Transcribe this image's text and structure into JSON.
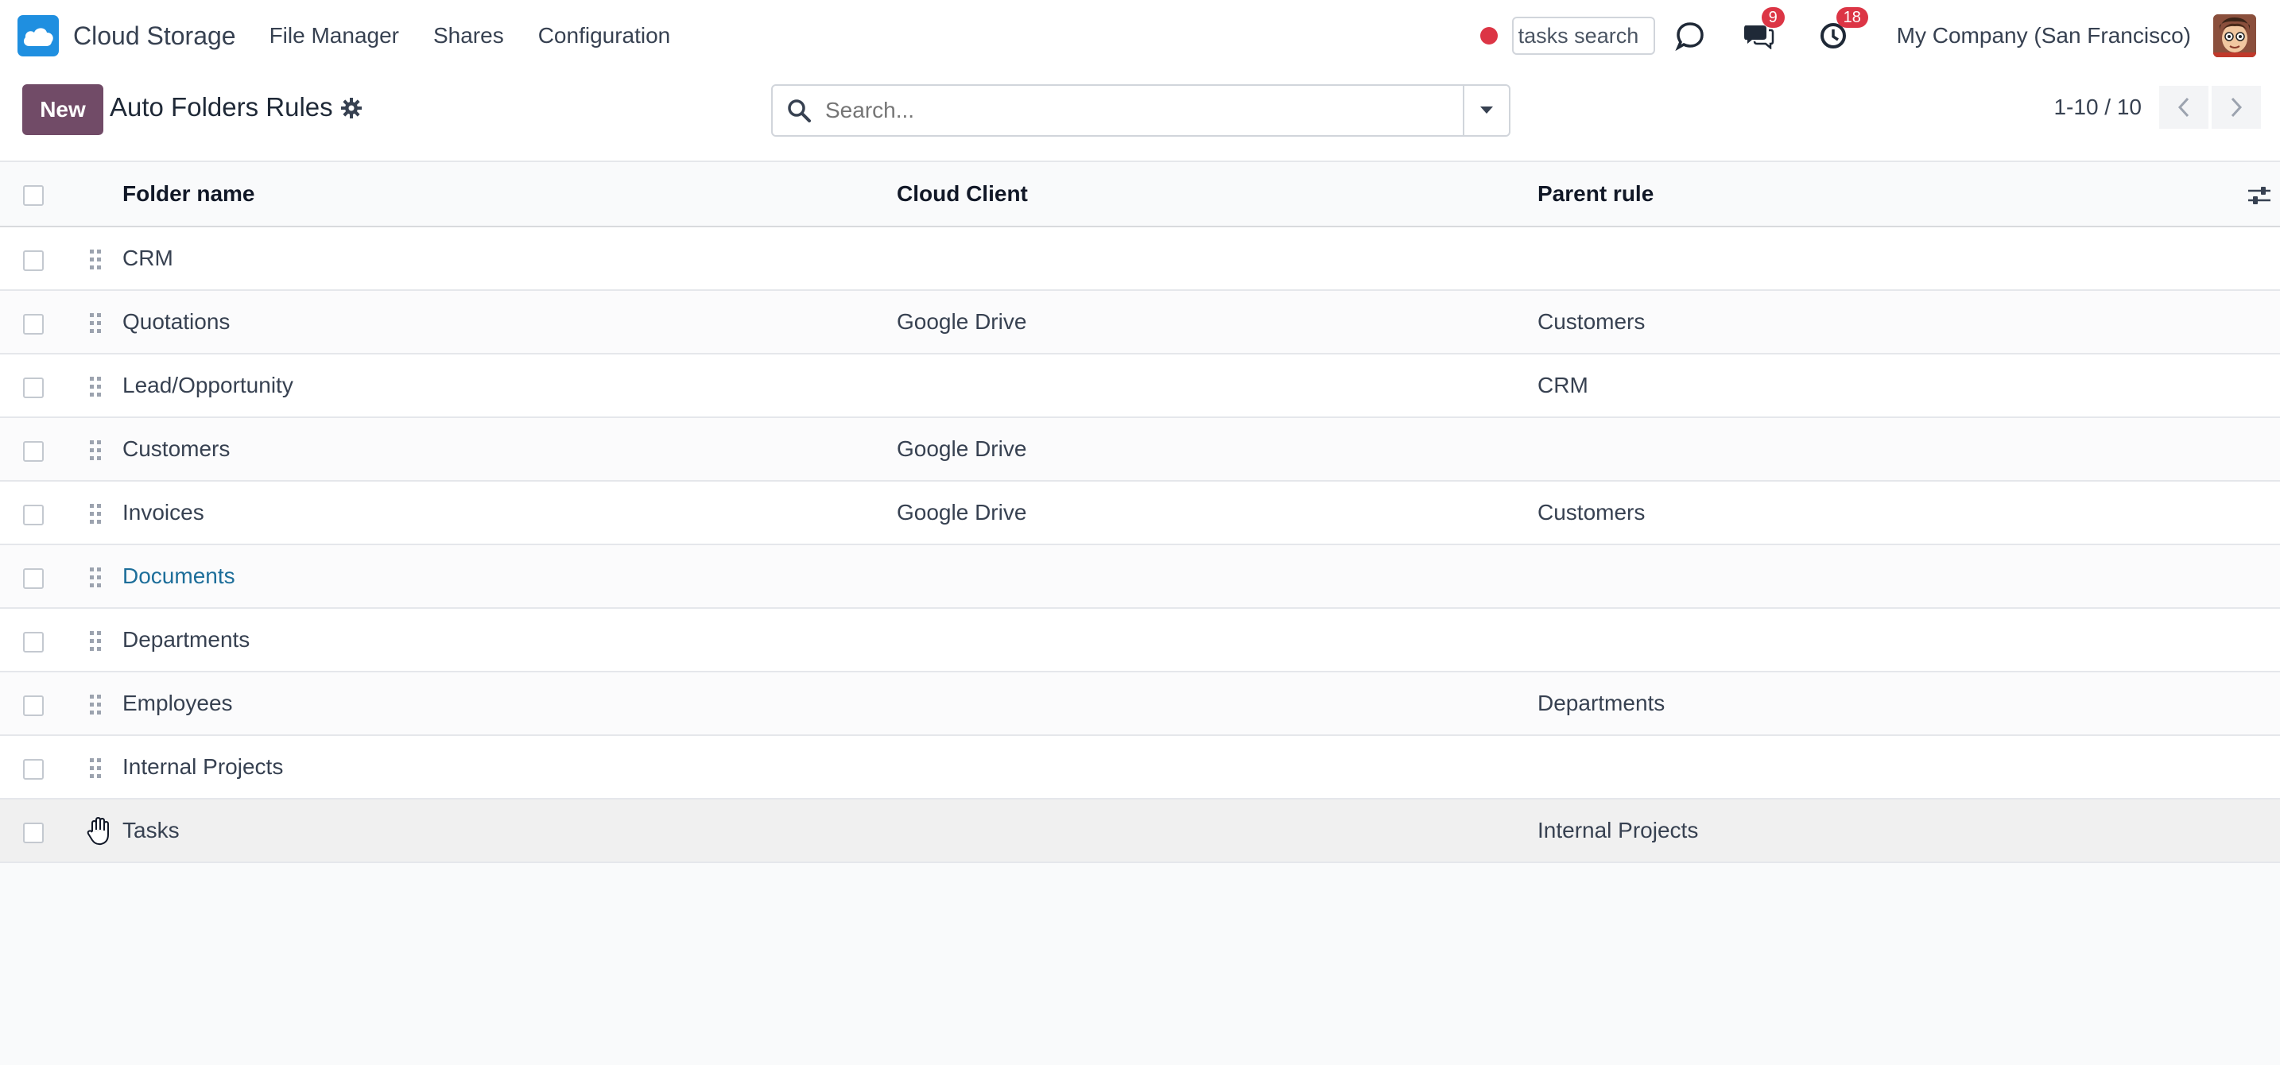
{
  "app": {
    "name": "Cloud Storage"
  },
  "menu": [
    "File Manager",
    "Shares",
    "Configuration"
  ],
  "systray": {
    "tasks_search_value": "tasks search",
    "messages_badge": "9",
    "activities_badge": "18",
    "company": "My Company (San Francisco)"
  },
  "control": {
    "new_label": "New",
    "title": "Auto Folders Rules",
    "search_placeholder": "Search...",
    "pager": "1-10 / 10"
  },
  "table": {
    "columns": [
      "Folder name",
      "Cloud Client",
      "Parent rule"
    ],
    "rows": [
      {
        "name": "CRM",
        "client": "",
        "parent": ""
      },
      {
        "name": "Quotations",
        "client": "Google Drive",
        "parent": "Customers"
      },
      {
        "name": "Lead/Opportunity",
        "client": "",
        "parent": "CRM"
      },
      {
        "name": "Customers",
        "client": "Google Drive",
        "parent": ""
      },
      {
        "name": "Invoices",
        "client": "Google Drive",
        "parent": "Customers"
      },
      {
        "name": "Documents",
        "client": "",
        "parent": ""
      },
      {
        "name": "Departments",
        "client": "",
        "parent": ""
      },
      {
        "name": "Employees",
        "client": "",
        "parent": "Departments"
      },
      {
        "name": "Internal Projects",
        "client": "",
        "parent": ""
      },
      {
        "name": "Tasks",
        "client": "",
        "parent": "Internal Projects"
      }
    ]
  },
  "colors": {
    "primary": "#714b67",
    "badge": "#dc3545",
    "link": "#1d6e9a",
    "logo": "#1f8fe0"
  },
  "icons": [
    "cloud-logo-icon",
    "settings-gear-icon",
    "search-icon",
    "caret-down-icon",
    "chevron-left-icon",
    "chevron-right-icon",
    "discuss-icon",
    "messages-icon",
    "activity-clock-icon",
    "column-settings-icon",
    "drag-handle-icon",
    "grab-hand-cursor-icon"
  ]
}
